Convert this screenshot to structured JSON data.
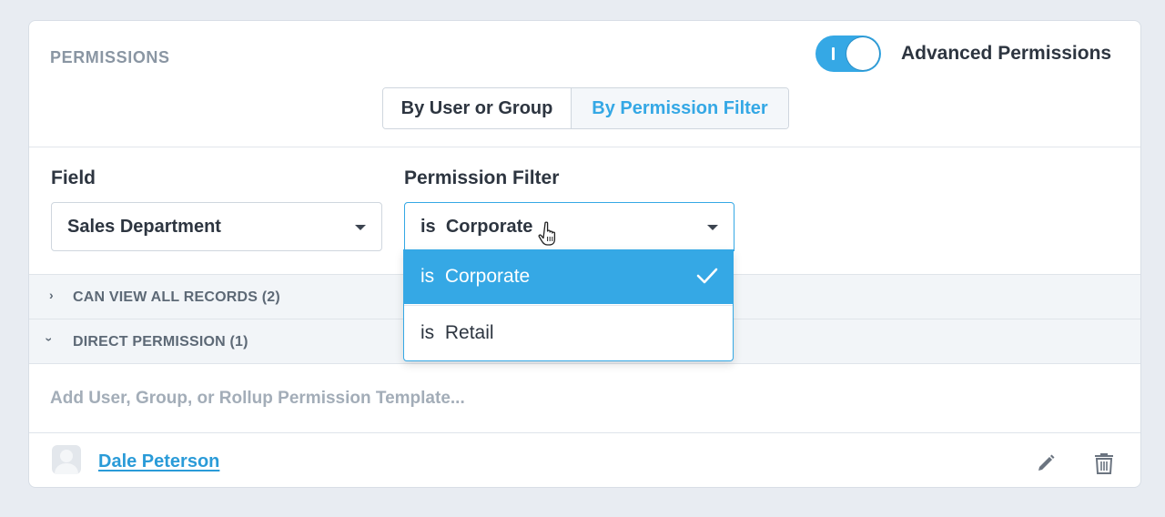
{
  "header": {
    "title": "PERMISSIONS",
    "advanced_toggle_label": "Advanced Permissions",
    "advanced_toggle_on": true
  },
  "tabs": [
    {
      "label": "By User or Group",
      "active": false
    },
    {
      "label": "By Permission Filter",
      "active": true
    }
  ],
  "filters": {
    "field_label": "Field",
    "field_value": "Sales Department",
    "permission_filter_label": "Permission Filter",
    "permission_filter_prefix": "is",
    "permission_filter_value": "Corporate",
    "options": [
      {
        "prefix": "is",
        "label": "Corporate",
        "selected": true
      },
      {
        "prefix": "is",
        "label": "Retail",
        "selected": false
      }
    ]
  },
  "sections": [
    {
      "label": "CAN VIEW ALL RECORDS (2)",
      "expanded": false
    },
    {
      "label": "DIRECT PERMISSION (1)",
      "expanded": true
    }
  ],
  "add_input": {
    "placeholder": "Add User, Group, or Rollup Permission Template..."
  },
  "users": [
    {
      "name": "Dale Peterson"
    }
  ],
  "colors": {
    "accent": "#35a8e5",
    "text": "#2d3540",
    "muted": "#8a96a3"
  }
}
